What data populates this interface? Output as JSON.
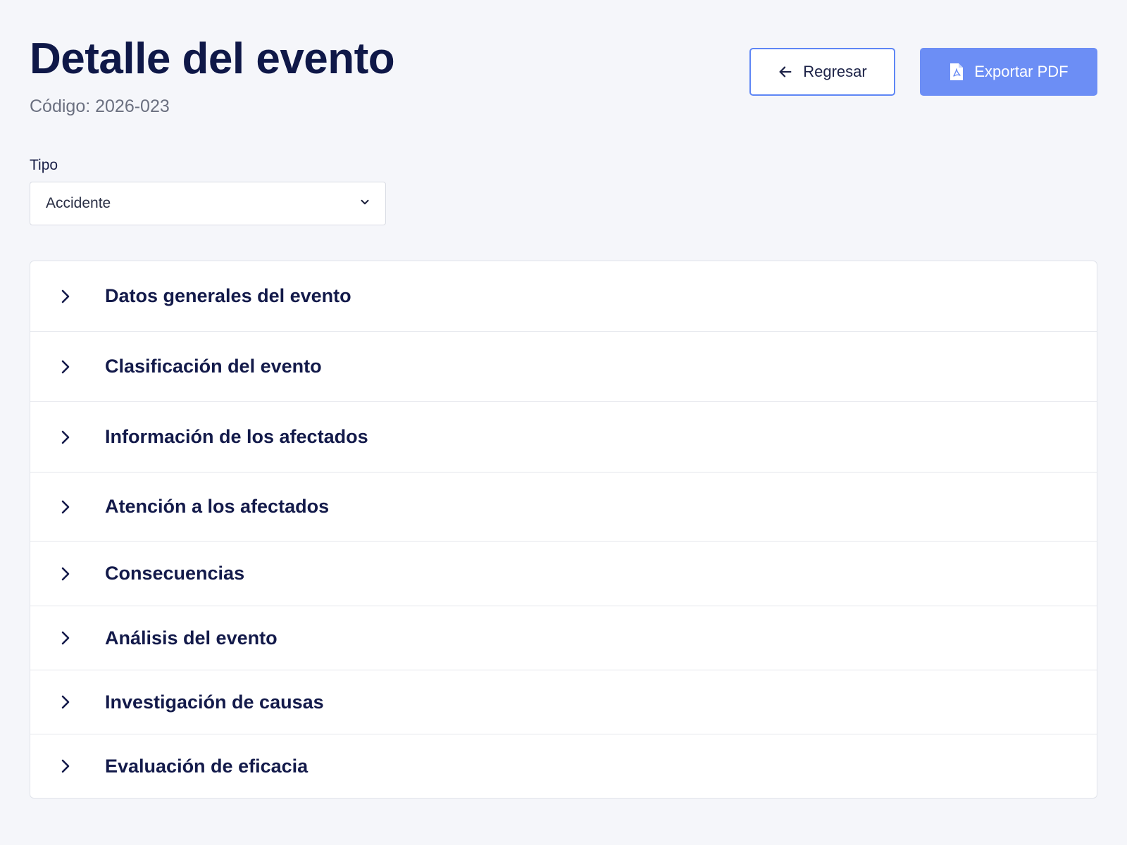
{
  "header": {
    "title": "Detalle del evento",
    "code": "Código: 2026-023"
  },
  "actions": {
    "back_label": "Regresar",
    "back_icon": "arrow-left-icon",
    "export_label": "Exportar PDF",
    "export_icon": "pdf-file-icon"
  },
  "type_field": {
    "label": "Tipo",
    "selected": "Accidente",
    "icon": "chevron-down-icon"
  },
  "sections": [
    {
      "label": "Datos generales del evento"
    },
    {
      "label": "Clasificación del evento"
    },
    {
      "label": "Información de los afectados"
    },
    {
      "label": "Atención a los afectados"
    },
    {
      "label": "Consecuencias"
    },
    {
      "label": "Análisis del evento"
    },
    {
      "label": "Investigación de causas"
    },
    {
      "label": "Evaluación de eficacia"
    }
  ],
  "colors": {
    "background": "#f5f6fa",
    "title": "#0f1848",
    "accent": "#6c8ef5",
    "border": "#e0e3ea"
  }
}
